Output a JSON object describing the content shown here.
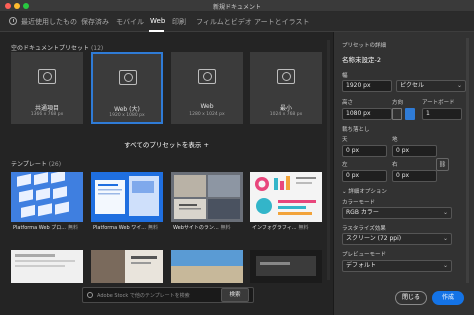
{
  "window": {
    "title": "新規ドキュメント"
  },
  "tabs": [
    {
      "label": "最近使用したもの"
    },
    {
      "label": "保存済み"
    },
    {
      "label": "モバイル"
    },
    {
      "label": "Web"
    },
    {
      "label": "印刷"
    },
    {
      "label": "フィルムとビデオ"
    },
    {
      "label": "アートとイラスト"
    }
  ],
  "active_tab": "Web",
  "blank_presets": {
    "heading": "空のドキュメントプリセット",
    "count": "(12)",
    "items": [
      {
        "name": "共通項目",
        "dims": "1366 x 768 px"
      },
      {
        "name": "Web (大)",
        "dims": "1920 x 1080 px"
      },
      {
        "name": "Web",
        "dims": "1280 x 1024 px"
      },
      {
        "name": "最小",
        "dims": "1024 x 768 px"
      }
    ],
    "view_all": "すべてのプリセットを表示 +"
  },
  "templates": {
    "heading": "テンプレート",
    "count": "(26)",
    "items": [
      {
        "name": "Platforma Web ブロ...",
        "badge": "無料"
      },
      {
        "name": "Platforma Web ワイ...",
        "badge": "無料"
      },
      {
        "name": "Webサイトのラン...",
        "badge": "無料"
      },
      {
        "name": "インフォグラフィ...",
        "badge": "無料"
      }
    ]
  },
  "stock_search": {
    "placeholder": "Adobe Stock で他のテンプレートを検索",
    "button": "検索"
  },
  "details": {
    "heading": "プリセットの詳細",
    "doc_name": "名称未設定-2",
    "width_label": "幅",
    "width_value": "1920 px",
    "unit": "ピクセル",
    "height_label": "高さ",
    "height_value": "1080 px",
    "orientation_label": "方向",
    "artboard_label": "アートボード",
    "artboard_count": "1",
    "bleed_label": "裁ち落とし",
    "top_label": "天",
    "top_value": "0 px",
    "bottom_label": "地",
    "bottom_value": "0 px",
    "left_label": "左",
    "left_value": "0 px",
    "right_label": "右",
    "right_value": "0 px",
    "advanced_label": "詳細オプション",
    "color_mode_label": "カラーモード",
    "color_mode_value": "RGB カラー",
    "raster_label": "ラスタライズ効果",
    "raster_value": "スクリーン (72 ppi)",
    "preview_label": "プレビューモード",
    "preview_value": "デフォルト",
    "close_btn": "閉じる",
    "create_btn": "作成"
  },
  "colors": {
    "accent": "#1473e6",
    "selection": "#2f7bd6",
    "background": "#242424",
    "panel": "#323232"
  }
}
